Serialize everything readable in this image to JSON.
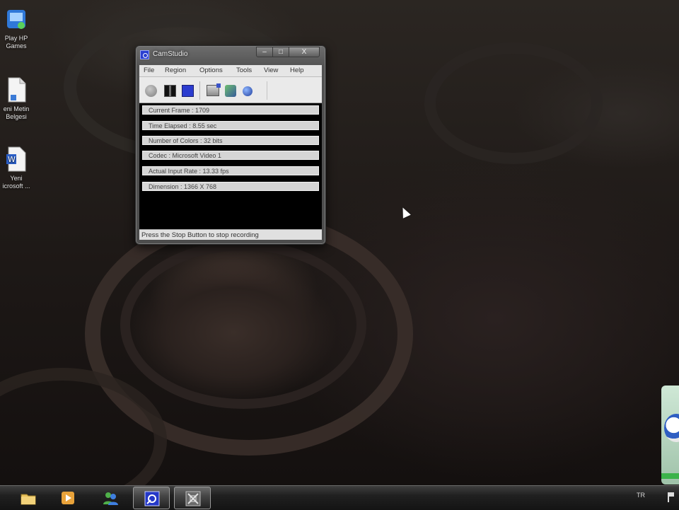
{
  "desktop": {
    "icons": [
      {
        "label_lines": [
          "Play HP",
          "Games"
        ],
        "icon": "games-icon"
      },
      {
        "label_lines": [
          "eni Metin",
          "Belgesi"
        ],
        "icon": "text-document-icon"
      },
      {
        "label_lines": [
          "Yeni",
          "icrosoft ..."
        ],
        "icon": "word-document-icon"
      }
    ]
  },
  "window": {
    "title": "CamStudio",
    "icon": "camstudio-icon",
    "caption_buttons": {
      "minimize": "‒",
      "maximize": "□",
      "close": "X"
    },
    "menu": [
      "File",
      "Region",
      "Options",
      "Tools",
      "View",
      "Help"
    ],
    "toolbar": [
      "record-icon",
      "pause-icon",
      "stop-icon",
      "region-icon",
      "options-icon",
      "web-icon"
    ],
    "info_rows": [
      "Current Frame : 1709",
      "Time Elapsed : 8.55 sec",
      "Number of Colors : 32 bits",
      "Codec : Microsoft Video 1",
      "Actual Input Rate : 13.33 fps",
      "Dimension : 1366 X 768"
    ],
    "status": "Press the Stop Button to stop recording"
  },
  "taskbar": {
    "items": [
      "file-explorer-icon",
      "media-player-icon",
      "messenger-icon",
      "camstudio-icon",
      "unknown-app-icon"
    ],
    "active_index": 3,
    "language": "TR"
  }
}
